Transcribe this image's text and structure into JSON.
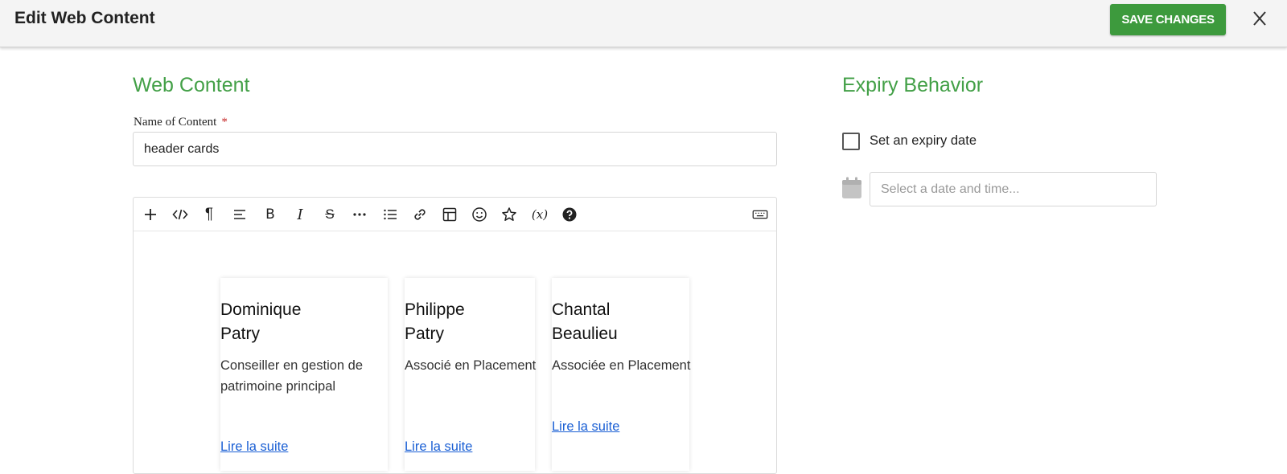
{
  "header": {
    "title": "Edit Web Content",
    "save_label": "SAVE CHANGES",
    "close_icon": "close-icon"
  },
  "main": {
    "section_title": "Web Content",
    "name_label": "Name of Content",
    "required_mark": "*",
    "name_value": "header cards",
    "toolbar": {
      "icons": [
        "plus-icon",
        "code-icon",
        "paragraph-icon",
        "align-icon",
        "bold-icon",
        "italic-icon",
        "strikethrough-icon",
        "more-icon",
        "list-icon",
        "link-icon",
        "table-icon",
        "emoji-icon",
        "star-icon",
        "variable-icon",
        "help-icon",
        "keyboard-icon"
      ],
      "bold_glyph": "B",
      "italic_glyph": "I",
      "strike_glyph": "S",
      "paragraph_glyph": "¶",
      "variable_glyph": "(x)"
    },
    "cards": [
      {
        "name_line1": "Dominique",
        "name_line2": "Patry",
        "role_line1": "Conseiller en gestion de",
        "role_line2": "patrimoine principal",
        "link": "Lire la suite"
      },
      {
        "name_line1": "Philippe",
        "name_line2": "Patry",
        "role_line1": "Associé en Placement",
        "role_line2": "",
        "link": "Lire la suite"
      },
      {
        "name_line1": "Chantal",
        "name_line2": "Beaulieu",
        "role_line1": "Associée en Placement",
        "role_line2": "",
        "link": "Lire la suite"
      }
    ]
  },
  "expiry": {
    "section_title": "Expiry Behavior",
    "checkbox_label": "Set an expiry date",
    "checked": false,
    "date_placeholder": "Select a date and time..."
  },
  "colors": {
    "accent": "#43a047",
    "button": "#3d9a3d",
    "link": "#1a5fd4",
    "required": "#c62828"
  }
}
